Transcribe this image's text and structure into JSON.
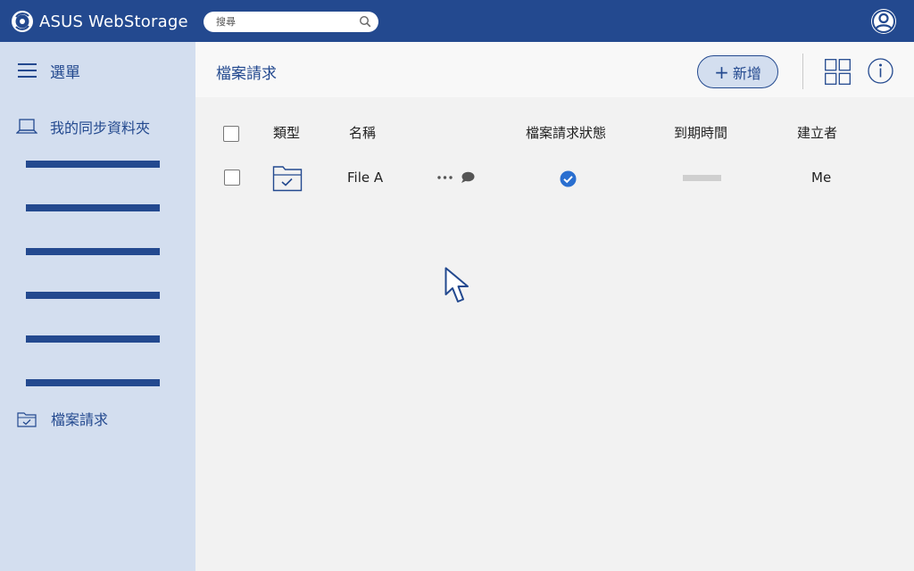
{
  "app": {
    "brand": "ASUS WebStorage"
  },
  "search": {
    "placeholder": "搜尋"
  },
  "sidebar": {
    "menu_label": "選單",
    "sync_folder_label": "我的同步資料夾",
    "file_request_label": "檔案請求"
  },
  "header": {
    "title": "檔案請求",
    "new_button_label": "新增",
    "new_button_plus": "+"
  },
  "table": {
    "columns": [
      "類型",
      "名稱",
      "檔案請求狀態",
      "到期時間",
      "建立者"
    ],
    "rows": [
      {
        "name": "File A",
        "status": "checked",
        "expiry": "",
        "creator": "Me"
      }
    ]
  },
  "colors": {
    "brand_blue": "#23498f",
    "sidebar_bg": "#d3deef",
    "status_check": "#2a6fd0"
  },
  "icons": [
    "asus-webstorage-logo-icon",
    "search-icon",
    "user-icon",
    "menu-icon",
    "laptop-sync-icon",
    "folder-check-icon",
    "grid-view-icon",
    "info-icon",
    "more-icon",
    "comment-icon",
    "check-circle-icon",
    "cursor-icon"
  ]
}
